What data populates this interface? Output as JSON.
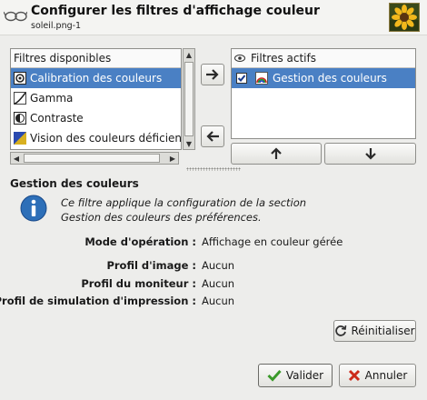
{
  "header": {
    "title": "Configurer les filtres d'affichage couleur",
    "subtitle": "soleil.png-1"
  },
  "available_filters": {
    "header": "Filtres disponibles",
    "items": [
      {
        "label": "Calibration des couleurs",
        "icon": "color-calibration-icon",
        "selected": true
      },
      {
        "label": "Gamma",
        "icon": "gamma-icon",
        "selected": false
      },
      {
        "label": "Contraste",
        "icon": "contrast-icon",
        "selected": false
      },
      {
        "label": "Vision des couleurs déficiente",
        "icon": "color-deficient-vision-icon",
        "selected": false
      }
    ]
  },
  "active_filters": {
    "header": "Filtres actifs",
    "header_icon": "eye-icon",
    "items": [
      {
        "label": "Gestion des couleurs",
        "icon": "color-management-icon",
        "checked": true,
        "selected": true
      }
    ]
  },
  "info": {
    "title": "Gestion des couleurs",
    "line1": "Ce filtre applique la configuration de la section",
    "line2": "Gestion des couleurs des préférences."
  },
  "properties": {
    "mode_label": "Mode d'opération :",
    "mode_value": "Affichage en couleur gérée",
    "image_profile_label": "Profil d'image :",
    "image_profile_value": "Aucun",
    "monitor_profile_label": "Profil du moniteur :",
    "monitor_profile_value": "Aucun",
    "print_sim_label": "Profil de simulation d'impression :",
    "print_sim_value": "Aucun"
  },
  "buttons": {
    "reset": "Réinitialiser",
    "ok": "Valider",
    "cancel": "Annuler"
  },
  "colors": {
    "selection": "#4a80c4",
    "ok_check": "#3a9a2a",
    "cancel_x": "#cc2a1a",
    "info_blue": "#2d6fb8"
  }
}
